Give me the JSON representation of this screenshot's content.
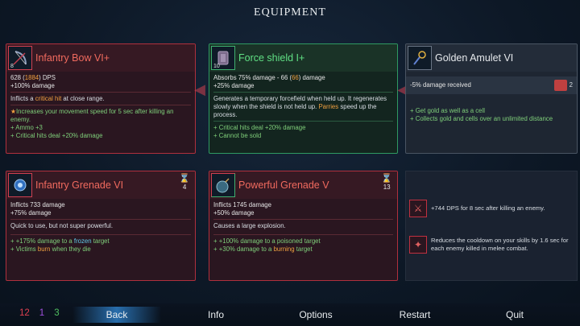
{
  "title": "EQUIPMENT",
  "cards": {
    "bow": {
      "name": "Infantry Bow VI+",
      "level": "8",
      "icon": "bow-icon",
      "dps_prefix": "628 (",
      "dps_highlight": "1884",
      "dps_suffix": ") DPS",
      "bonus": "+100% damage",
      "desc_prefix": "Inflicts a ",
      "desc_highlight": "critical hit",
      "desc_suffix": " at close range.",
      "affix1": "Increases your movement speed for 5 sec after killing an enemy.",
      "affix2": "+ Ammo +3",
      "affix3": "+ Critical hits deal +20% damage"
    },
    "shield": {
      "name": "Force shield I+",
      "level": "10",
      "icon": "shield-icon",
      "stat_prefix": "Absorbs 75% damage - 66 (",
      "stat_highlight": "66",
      "stat_suffix": ") damage",
      "bonus": "+25% damage",
      "desc_prefix": "Generates a temporary forcefield when held up. It regenerates slowly when the shield is not held up. ",
      "desc_highlight": "Parries",
      "desc_suffix": " speed up the process.",
      "affix1": "+ Critical hits deal +20% damage",
      "affix2": "+ Cannot be sold"
    },
    "amulet": {
      "name": "Golden Amulet VI",
      "icon": "amulet-icon",
      "stat": "-5% damage received",
      "scroll_count": "2",
      "affix1": "+ Get gold as well as a cell",
      "affix2": "+ Collects gold and cells over an unlimited distance"
    },
    "grenade1": {
      "name": "Infantry Grenade VI",
      "icon": "grenade-icon",
      "ammo": "4",
      "stat": "Inflicts 733 damage",
      "bonus": "+75% damage",
      "desc": "Quick to use, but not super powerful.",
      "affix1_prefix": "+ +175% damage to a ",
      "affix1_highlight": "frozen",
      "affix1_suffix": " target",
      "affix2_prefix": "+ Victims ",
      "affix2_highlight": "burn",
      "affix2_suffix": " when they die"
    },
    "grenade2": {
      "name": "Powerful Grenade V",
      "icon": "bomb-icon",
      "ammo": "13",
      "stat": "Inflicts 1745 damage",
      "bonus": "+50% damage",
      "desc": "Causes a large explosion.",
      "affix1_prefix": "+ +100% damage to a ",
      "affix1_highlight": "poisoned",
      "affix1_suffix": " target",
      "affix2_prefix": "+ +30% damage to a ",
      "affix2_highlight": "burning",
      "affix2_suffix": " target"
    }
  },
  "mutations": [
    {
      "icon": "sword-icon",
      "text": "+744 DPS for 8 sec after killing an enemy."
    },
    {
      "icon": "cooldown-icon",
      "text": "Reduces the cooldown on your skills by 1.6 sec for each enemy killed in melee combat."
    }
  ],
  "scrolls": {
    "red": "12",
    "purple": "1",
    "green": "3"
  },
  "menu": {
    "back": "Back",
    "info": "Info",
    "options": "Options",
    "restart": "Restart",
    "quit": "Quit"
  },
  "colors": {
    "brutality": "#e04050",
    "tactics": "#a050e0",
    "survival": "#50c060",
    "highlight": "#f0a040"
  }
}
